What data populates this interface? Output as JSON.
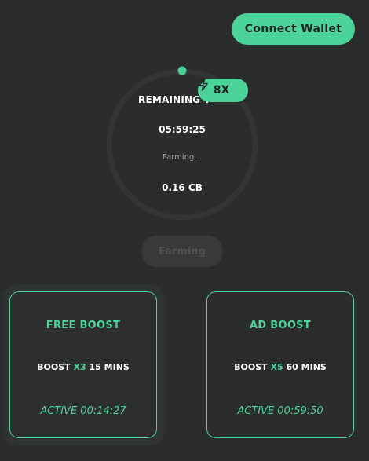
{
  "header": {
    "connect_wallet_label": "Connect Wallet"
  },
  "farming_panel": {
    "remaining_label": "REMAINING T",
    "boost_multiplier": "8X",
    "timer": "05:59:25",
    "status": "Farming...",
    "balance": "0.16 CB",
    "farming_button_label": "Farming",
    "progress_fraction": 0.0
  },
  "boosts": [
    {
      "title": "FREE BOOST",
      "prefix": "BOOST",
      "multiplier": "X3",
      "duration": "15 MINS",
      "active": "ACTIVE 00:14:27"
    },
    {
      "title": "AD BOOST",
      "prefix": "BOOST",
      "multiplier": "X5",
      "duration": "60 MINS",
      "active": "ACTIVE 00:59:50"
    }
  ],
  "colors": {
    "accent": "#4cd39a",
    "background": "#2b2c2c",
    "ring_track": "#3a3c3c",
    "disabled_button": "#383a3a"
  },
  "icons": {
    "boost_badge": "lightning-bolt-icon"
  }
}
